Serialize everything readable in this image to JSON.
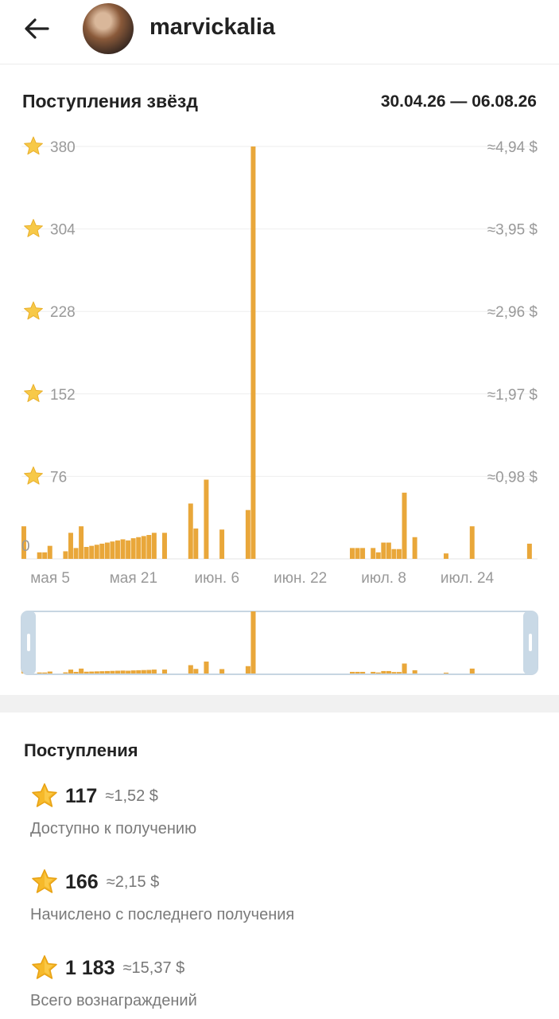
{
  "header": {
    "back_icon": "arrow-left-icon",
    "channel_name": "marvickalia"
  },
  "chart_section": {
    "title": "Поступления звёзд",
    "date_range": "30.04.26 — 06.08.26"
  },
  "chart_data": {
    "type": "bar",
    "title": "Поступления звёзд",
    "color": "#e9a73a",
    "ylim": [
      0,
      380
    ],
    "y_ticks": [
      "380",
      "304",
      "228",
      "152",
      "76",
      "0"
    ],
    "y_tick_values": [
      380,
      304,
      228,
      152,
      76,
      0
    ],
    "y2_ticks": [
      "≈4,94 $",
      "≈3,95 $",
      "≈2,96 $",
      "≈1,97 $",
      "≈0,98 $"
    ],
    "x_tick_labels": [
      "мая 5",
      "мая 21",
      "июн. 6",
      "июн. 22",
      "июл. 8",
      "июл. 24"
    ],
    "x_tick_days": [
      5,
      21,
      37,
      53,
      69,
      85
    ],
    "x_start": "30.04.26",
    "days": [
      0,
      1,
      2,
      3,
      4,
      5,
      6,
      7,
      8,
      9,
      10,
      11,
      12,
      13,
      14,
      15,
      16,
      17,
      18,
      19,
      20,
      21,
      22,
      23,
      24,
      25,
      26,
      27,
      28,
      29,
      30,
      31,
      32,
      33,
      34,
      35,
      36,
      37,
      38,
      39,
      40,
      41,
      42,
      43,
      44,
      45,
      46,
      47,
      48,
      49,
      50,
      51,
      52,
      53,
      54,
      55,
      56,
      57,
      58,
      59,
      60,
      61,
      62,
      63,
      64,
      65,
      66,
      67,
      68,
      69,
      70,
      71,
      72,
      73,
      74,
      75,
      76,
      77,
      78,
      79,
      80,
      81,
      82,
      83,
      84,
      85,
      86,
      87,
      88,
      89,
      90,
      91,
      92,
      93,
      94,
      95,
      96,
      97,
      98
    ],
    "values": [
      30,
      0,
      0,
      6,
      6,
      12,
      0,
      0,
      7,
      24,
      10,
      30,
      11,
      12,
      13,
      14,
      15,
      16,
      17,
      18,
      17,
      19,
      20,
      21,
      22,
      24,
      0,
      24,
      0,
      0,
      0,
      0,
      51,
      28,
      0,
      73,
      0,
      0,
      27,
      0,
      0,
      0,
      0,
      45,
      380,
      0,
      0,
      0,
      0,
      0,
      0,
      0,
      0,
      0,
      0,
      0,
      0,
      0,
      0,
      0,
      0,
      0,
      0,
      10,
      10,
      10,
      0,
      10,
      6,
      15,
      15,
      9,
      9,
      61,
      0,
      20,
      0,
      0,
      0,
      0,
      0,
      5,
      0,
      0,
      0,
      0,
      30,
      0,
      0,
      0,
      0,
      0,
      0,
      0,
      0,
      0,
      0,
      14,
      0
    ]
  },
  "navigator": {
    "left_handle_icon": "drag-handle-icon",
    "right_handle_icon": "drag-handle-icon"
  },
  "income": {
    "title": "Поступления",
    "star_icon": "star-icon",
    "items": [
      {
        "value": "117",
        "usd": "≈1,52 $",
        "label": "Доступно к получению"
      },
      {
        "value": "166",
        "usd": "≈2,15 $",
        "label": "Начислено с последнего получения"
      },
      {
        "value": "1 183",
        "usd": "≈15,37 $",
        "label": "Всего вознаграждений"
      }
    ]
  }
}
